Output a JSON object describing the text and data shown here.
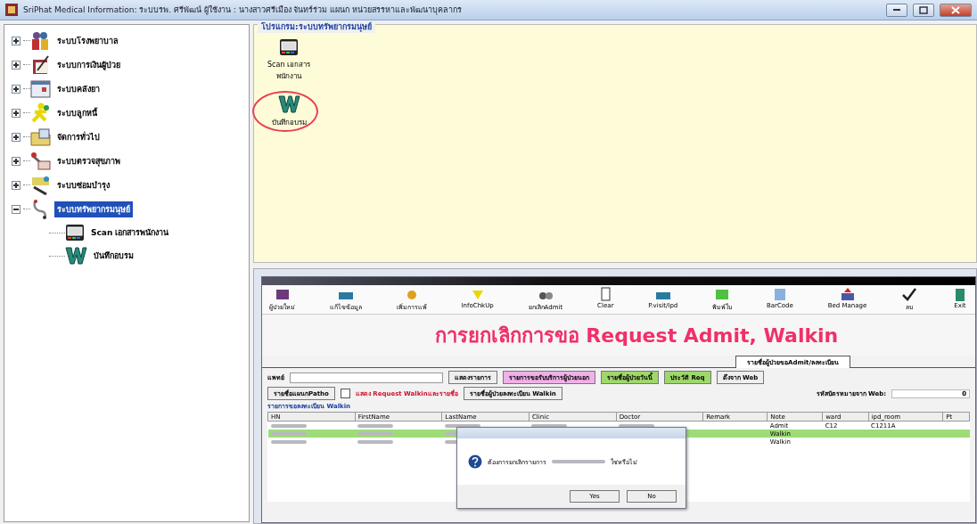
{
  "window": {
    "title": "SriPhat Medical Information: ระบบรพ. ศรีพัฒน์ ผู้ใช้งาน : นางสาวศรีเมือง จันทร์ร่วม แผนก หน่วยสรรหาและพัฒนาบุคลากร"
  },
  "tree": {
    "items": [
      {
        "label": "ระบบโรงพยาบาล",
        "expanded": false,
        "selected": false
      },
      {
        "label": "ระบบการเงินผู้ป่วย",
        "expanded": false,
        "selected": false
      },
      {
        "label": "ระบบคลังยา",
        "expanded": false,
        "selected": false
      },
      {
        "label": "ระบบลูกหนี้",
        "expanded": false,
        "selected": false
      },
      {
        "label": "จัดการทั่วไป",
        "expanded": false,
        "selected": false
      },
      {
        "label": "ระบบตรวจสุขภาพ",
        "expanded": false,
        "selected": false
      },
      {
        "label": "ระบบซ่อมบำรุง",
        "expanded": false,
        "selected": false
      },
      {
        "label": "ระบบทรัพยากรมนุษย์",
        "expanded": true,
        "selected": true,
        "children": [
          {
            "label": "Scan เอกสารพนักงาน",
            "selected": false
          },
          {
            "label": "บันทึกอบรม",
            "selected": false
          }
        ]
      }
    ]
  },
  "program_panel": {
    "title": "โปรแกรม:ระบบทรัพยากรมนุษย์",
    "shortcuts": [
      {
        "label": "Scan เอกสาร พนักงาน",
        "highlighted": false
      },
      {
        "label": "บันทึกอบรม",
        "highlighted": true
      }
    ]
  },
  "embedded_window": {
    "toolbar": [
      "ผู้ป่วยใหม่",
      "แก้ไขข้อมูล",
      "เพิ่มการแพ้",
      "InfoChkUp",
      "ยกเลิกAdmit",
      "Clear",
      "P.visit/Ipd",
      "พิมพ์ใบ",
      "BarCode",
      "Bed Manage",
      "ลบ",
      "Exit"
    ],
    "banner": "การยกเลิกการขอ Request Admit, Walkin",
    "tabs": [
      {
        "label": "รายชื่อผู้ป่วยขอAdmit/ลงทะเบียน",
        "selected": true
      }
    ],
    "doctor_label": "แพทย์",
    "buttons_row1": [
      "แสดงรายการ",
      "รายการขอรับบริการผู้ป่วยนอก",
      "รายชื่อผู้ป่วยวันนี้",
      "ประวัติ Req",
      "ดึงจาก Web"
    ],
    "patho_button": "รายชื่อแผนกPatho",
    "walkin_checkbox": {
      "label": "แสดง Request Walkinและรายชื่อ",
      "checked": false
    },
    "walkin_list_button": "รายชื่อผู้ป่วยลงทะเบียน Walkin",
    "web_code_label": "รหัสบัตรหมายจาก Web:",
    "web_code_value": "0",
    "table": {
      "title": "รายการขอลงทะเบียน Walkin",
      "columns": [
        "HN",
        "FirstName",
        "LastName",
        "Clinic",
        "Doctor",
        "Remark",
        "Note",
        "ward",
        "ipd_room",
        "Pt"
      ],
      "rows": [
        {
          "note": "Admit",
          "ward": "C12",
          "ipd_room": "C1211A",
          "selected": false
        },
        {
          "note": "Walkin",
          "selected": true
        },
        {
          "note": "Walkin",
          "selected": false
        }
      ]
    },
    "dialog": {
      "message_start": "ต้องการยกเลิกรายการ",
      "message_end": "ใช่หรือไม่",
      "buttons": [
        "Yes",
        "No"
      ]
    }
  }
}
